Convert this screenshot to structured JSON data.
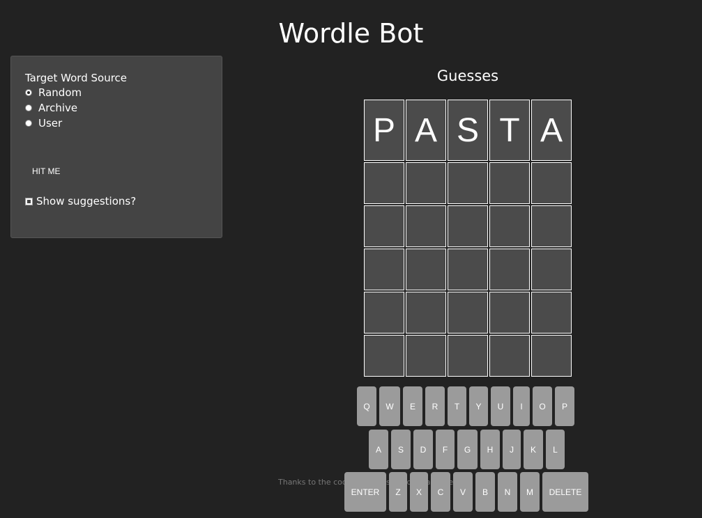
{
  "app": {
    "title": "Wordle Bot"
  },
  "settings": {
    "legend": "Target Word Source",
    "options": [
      {
        "label": "Random",
        "checked": true
      },
      {
        "label": "Archive",
        "checked": false
      },
      {
        "label": "User",
        "checked": false
      }
    ],
    "hit_label": "HIT ME",
    "suggestions_label": "Show suggestions?"
  },
  "guesses": {
    "heading": "Guesses",
    "rows": [
      [
        "P",
        "A",
        "S",
        "T",
        "A"
      ],
      [
        "",
        "",
        "",
        "",
        ""
      ],
      [
        "",
        "",
        "",
        "",
        ""
      ],
      [
        "",
        "",
        "",
        "",
        ""
      ],
      [
        "",
        "",
        "",
        "",
        ""
      ],
      [
        "",
        "",
        "",
        "",
        ""
      ]
    ]
  },
  "keyboard": {
    "row1": [
      "Q",
      "W",
      "E",
      "R",
      "T",
      "Y",
      "U",
      "I",
      "O",
      "P"
    ],
    "row2": [
      "A",
      "S",
      "D",
      "F",
      "G",
      "H",
      "J",
      "K",
      "L"
    ],
    "row3": [
      "ENTER",
      "Z",
      "X",
      "C",
      "V",
      "B",
      "N",
      "M",
      "DELETE"
    ]
  },
  "footer": {
    "credits": "Thanks to the coolbutuseless/wordle package"
  },
  "colors": {
    "background": "#222222",
    "panel": "#444444",
    "tile": "#4b4b4b",
    "key": "#9b9b9b"
  }
}
